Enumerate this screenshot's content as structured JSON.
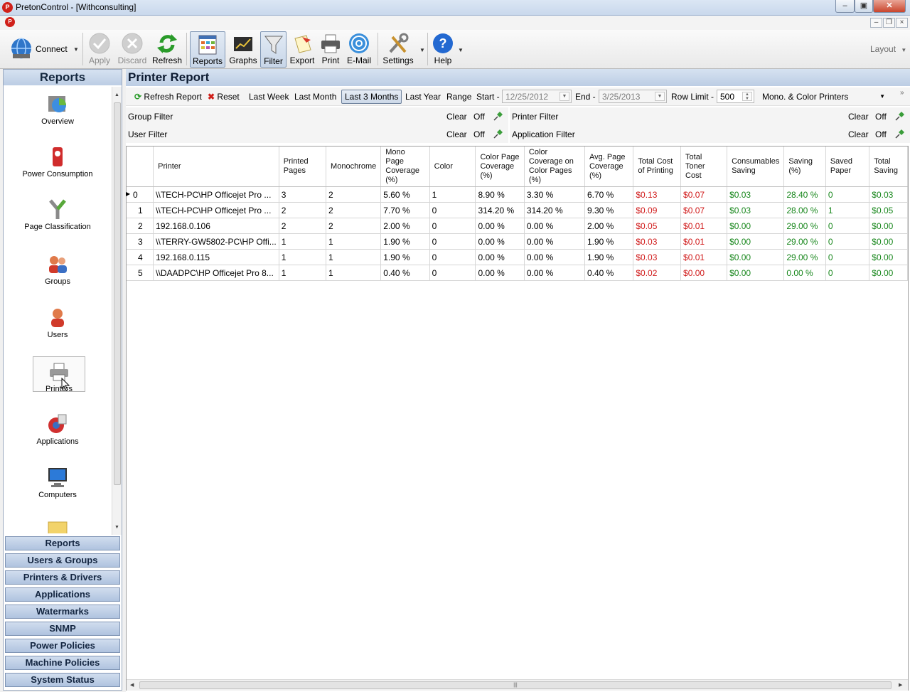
{
  "window": {
    "title": "PretonControl - [Withconsulting]",
    "app_icon_label": "P"
  },
  "toolbar": {
    "connect": "Connect",
    "apply": "Apply",
    "discard": "Discard",
    "refresh": "Refresh",
    "reports": "Reports",
    "graphs": "Graphs",
    "filter": "Filter",
    "export": "Export",
    "print": "Print",
    "email": "E-Mail",
    "settings": "Settings",
    "help": "Help",
    "layout": "Layout"
  },
  "sidebar": {
    "header": "Reports",
    "items": [
      "Overview",
      "Power Consumption",
      "Page Classification",
      "Groups",
      "Users",
      "Printers",
      "Applications",
      "Computers"
    ],
    "sections": [
      "Reports",
      "Users & Groups",
      "Printers & Drivers",
      "Applications",
      "Watermarks",
      "SNMP",
      "Power Policies",
      "Machine Policies",
      "System Status"
    ]
  },
  "report": {
    "title": "Printer Report",
    "refresh_report": "Refresh Report",
    "reset": "Reset",
    "last_week": "Last Week",
    "last_month": "Last Month",
    "last_3_months": "Last 3 Months",
    "last_year": "Last Year",
    "range": "Range",
    "start_label": "Start -",
    "start_value": "12/25/2012",
    "end_label": "End -",
    "end_value": "3/25/2013",
    "row_limit_label": "Row Limit -",
    "row_limit_value": "500",
    "printer_type": "Mono. & Color Printers",
    "group_filter": "Group Filter",
    "user_filter": "User Filter",
    "printer_filter": "Printer Filter",
    "application_filter": "Application Filter",
    "clear": "Clear",
    "off": "Off"
  },
  "table": {
    "columns": [
      "Printer",
      "Printed Pages",
      "Monochrome",
      "Mono Page Coverage (%)",
      "Color",
      "Color Page Coverage (%)",
      "Color Coverage on Color Pages (%)",
      "Avg. Page Coverage (%)",
      "Total Cost of Printing",
      "Total Toner Cost",
      "Consumables Saving",
      "Saving (%)",
      "Saved Paper",
      "Total Saving"
    ],
    "rows": [
      [
        "0",
        "\\\\TECH-PC\\HP Officejet Pro ...",
        "3",
        "2",
        "5.60 %",
        "1",
        "8.90 %",
        "3.30 %",
        "6.70 %",
        "$0.13",
        "$0.07",
        "$0.03",
        "28.40 %",
        "0",
        "$0.03"
      ],
      [
        "1",
        "\\\\TECH-PC\\HP Officejet Pro ...",
        "2",
        "2",
        "7.70 %",
        "0",
        "314.20 %",
        "314.20 %",
        "9.30 %",
        "$0.09",
        "$0.07",
        "$0.03",
        "28.00 %",
        "1",
        "$0.05"
      ],
      [
        "2",
        "192.168.0.106",
        "2",
        "2",
        "2.00 %",
        "0",
        "0.00 %",
        "0.00 %",
        "2.00 %",
        "$0.05",
        "$0.01",
        "$0.00",
        "29.00 %",
        "0",
        "$0.00"
      ],
      [
        "3",
        "\\\\TERRY-GW5802-PC\\HP Offi...",
        "1",
        "1",
        "1.90 %",
        "0",
        "0.00 %",
        "0.00 %",
        "1.90 %",
        "$0.03",
        "$0.01",
        "$0.00",
        "29.00 %",
        "0",
        "$0.00"
      ],
      [
        "4",
        "192.168.0.115",
        "1",
        "1",
        "1.90 %",
        "0",
        "0.00 %",
        "0.00 %",
        "1.90 %",
        "$0.03",
        "$0.01",
        "$0.00",
        "29.00 %",
        "0",
        "$0.00"
      ],
      [
        "5",
        "\\\\DAADPC\\HP Officejet Pro 8...",
        "1",
        "1",
        "0.40 %",
        "0",
        "0.00 %",
        "0.00 %",
        "0.40 %",
        "$0.02",
        "$0.00",
        "$0.00",
        "0.00 %",
        "0",
        "$0.00"
      ]
    ]
  },
  "colors": {
    "cost_red": "#d01919",
    "saving_green": "#18871c",
    "header_blue": "#bccde4"
  }
}
